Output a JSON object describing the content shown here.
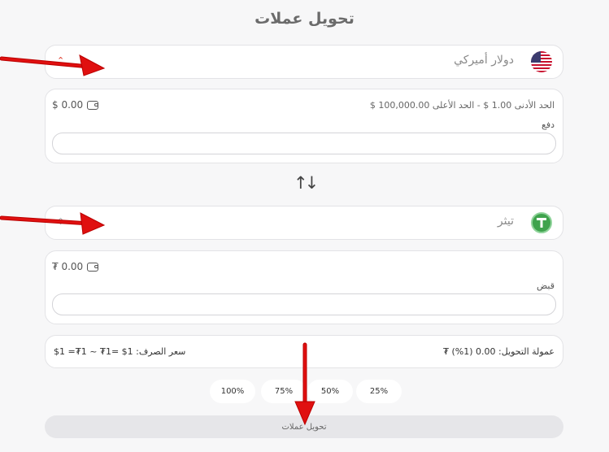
{
  "page": {
    "title": "تحويل عملات"
  },
  "from": {
    "currency": "دولار أميركي",
    "limits": "الحد الأدنى 1.00 $  -  الحد الأعلى 100,000.00 $",
    "balance": "$ 0.00",
    "field_label": "دفع",
    "field_value": ""
  },
  "to": {
    "currency": "تيثر",
    "balance": "₮ 0.00",
    "field_label": "قبض",
    "field_value": ""
  },
  "rate": {
    "fee": "عمولة التحويل: 0.00 (1%) ₮",
    "exchange": "سعر الصرف: 1$ =1₮ ~ 1₮= 1$"
  },
  "percentages": [
    "25%",
    "50%",
    "75%",
    "100%"
  ],
  "submit_label": "تحويل عملات",
  "colors": {
    "arrow": "#e01010",
    "accent_green": "#3fa34d",
    "background": "#f7f7f8"
  }
}
